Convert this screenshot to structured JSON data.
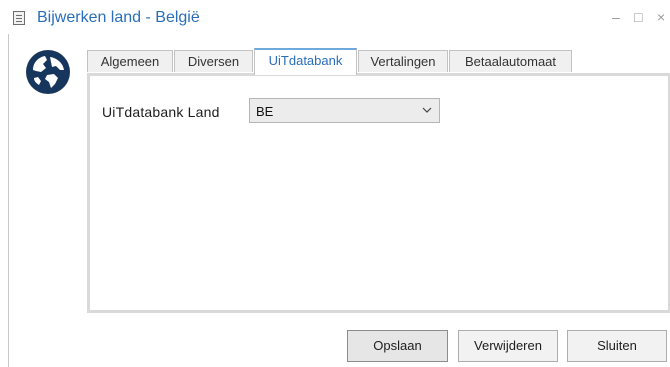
{
  "window": {
    "title": "Bijwerken land - België",
    "controls": {
      "minimize": "–",
      "maximize": "□",
      "close": "×"
    }
  },
  "tabs": [
    {
      "label": "Algemeen",
      "active": false
    },
    {
      "label": "Diversen",
      "active": false
    },
    {
      "label": "UiTdatabank",
      "active": true
    },
    {
      "label": "Vertalingen",
      "active": false
    },
    {
      "label": "Betaalautomaat",
      "active": false
    }
  ],
  "form": {
    "uitdatabank_land": {
      "label": "UiTdatabank Land",
      "value": "BE"
    }
  },
  "buttons": {
    "save": "Opslaan",
    "delete": "Verwijderen",
    "close": "Sluiten"
  },
  "colors": {
    "title": "#2a6ebb",
    "active_tab_text": "#2a6ebb",
    "globe": "#17365d"
  },
  "icons": {
    "title": "document-icon",
    "header": "globe-icon",
    "dropdown": "chevron-down-icon"
  }
}
